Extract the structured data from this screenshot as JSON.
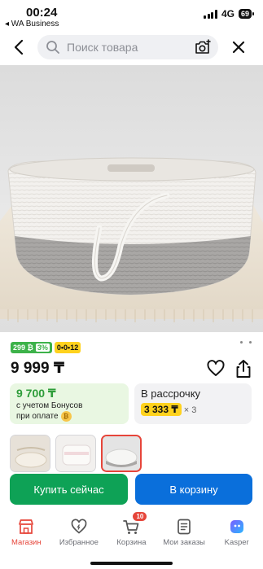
{
  "status": {
    "time": "00:24",
    "back_app": "◂ WA Business",
    "network": "4G",
    "battery": "69"
  },
  "search": {
    "placeholder": "Поиск товара"
  },
  "product": {
    "tag_bonus": "299 ₿",
    "tag_bonus_pct": "3%",
    "tag_installment": "0•0•12",
    "price": "9 999 ₸"
  },
  "bonus_card": {
    "value": "9 700 ₸",
    "line1": "с учетом Бонусов",
    "line2": "при оплате"
  },
  "installment_card": {
    "title": "В рассрочку",
    "amount": "3 333 ₸",
    "multiplier": "× 3"
  },
  "actions": {
    "buy_now": "Купить сейчас",
    "add_to_cart": "В корзину"
  },
  "nav": {
    "items": [
      {
        "label": "Магазин",
        "icon": "shop-icon"
      },
      {
        "label": "Избранное",
        "icon": "heart-icon"
      },
      {
        "label": "Корзина",
        "icon": "cart-icon",
        "badge": "10"
      },
      {
        "label": "Мои заказы",
        "icon": "orders-icon"
      },
      {
        "label": "Kasper",
        "icon": "kasper-icon"
      }
    ]
  },
  "colors": {
    "accent_red": "#e6453a",
    "buy_green": "#0ea256",
    "cart_blue": "#0a6fdb",
    "bonus_green": "#2e9d3a",
    "installment_yellow": "#ffd21e"
  }
}
